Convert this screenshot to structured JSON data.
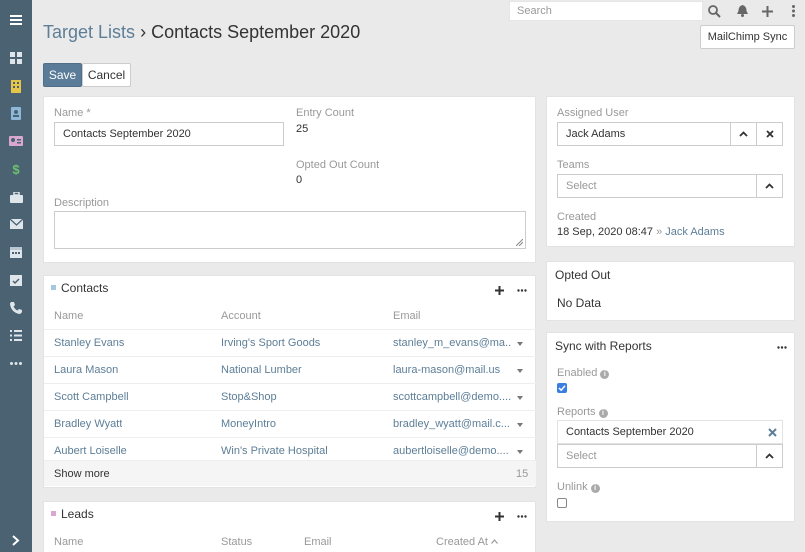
{
  "topbar": {
    "search_placeholder": "Search",
    "mailchimp_label": "MailChimp Sync"
  },
  "header": {
    "breadcrumb": "Target Lists",
    "separator": "›",
    "title": "Contacts September 2020"
  },
  "actions": {
    "save": "Save",
    "cancel": "Cancel"
  },
  "form": {
    "name_label": "Name *",
    "name_value": "Contacts September 2020",
    "entry_count_label": "Entry Count",
    "entry_count_value": "25",
    "opted_out_count_label": "Opted Out Count",
    "opted_out_count_value": "0",
    "description_label": "Description"
  },
  "contacts": {
    "title": "Contacts",
    "marker_color": "#a5c8e0",
    "columns": [
      "Name",
      "Account",
      "Email"
    ],
    "rows": [
      {
        "name": "Stanley Evans",
        "account": "Irving's Sport Goods",
        "email": "stanley_m_evans@ma..."
      },
      {
        "name": "Laura Mason",
        "account": "National Lumber",
        "email": "laura-mason@mail.us"
      },
      {
        "name": "Scott Campbell",
        "account": "Stop&Shop",
        "email": "scottcampbell@demo...."
      },
      {
        "name": "Bradley Wyatt",
        "account": "MoneyIntro",
        "email": "bradley_wyatt@mail.c..."
      },
      {
        "name": "Aubert Loiselle",
        "account": "Win's Private Hospital",
        "email": "aubertloiselle@demo...."
      }
    ],
    "show_more": "Show more",
    "total": "15"
  },
  "leads": {
    "title": "Leads",
    "marker_color": "#d9a7cf",
    "columns": [
      "Name",
      "Status",
      "Email",
      "Created At"
    ]
  },
  "side": {
    "assigned_user_label": "Assigned User",
    "assigned_user_value": "Jack Adams",
    "teams_label": "Teams",
    "teams_placeholder": "Select",
    "created_label": "Created",
    "created_date": "18 Sep, 2020 08:47",
    "created_sep": "»",
    "created_by": "Jack Adams"
  },
  "opted_out": {
    "title": "Opted Out",
    "empty": "No Data"
  },
  "sync": {
    "title": "Sync with Reports",
    "enabled_label": "Enabled",
    "enabled": true,
    "reports_label": "Reports",
    "report_item": "Contacts September 2020",
    "reports_placeholder": "Select",
    "unlink_label": "Unlink",
    "unlink": false
  },
  "colors": {
    "sidebar": "#4a6272",
    "primary": "#5b7c98",
    "link": "#5d7e97"
  }
}
